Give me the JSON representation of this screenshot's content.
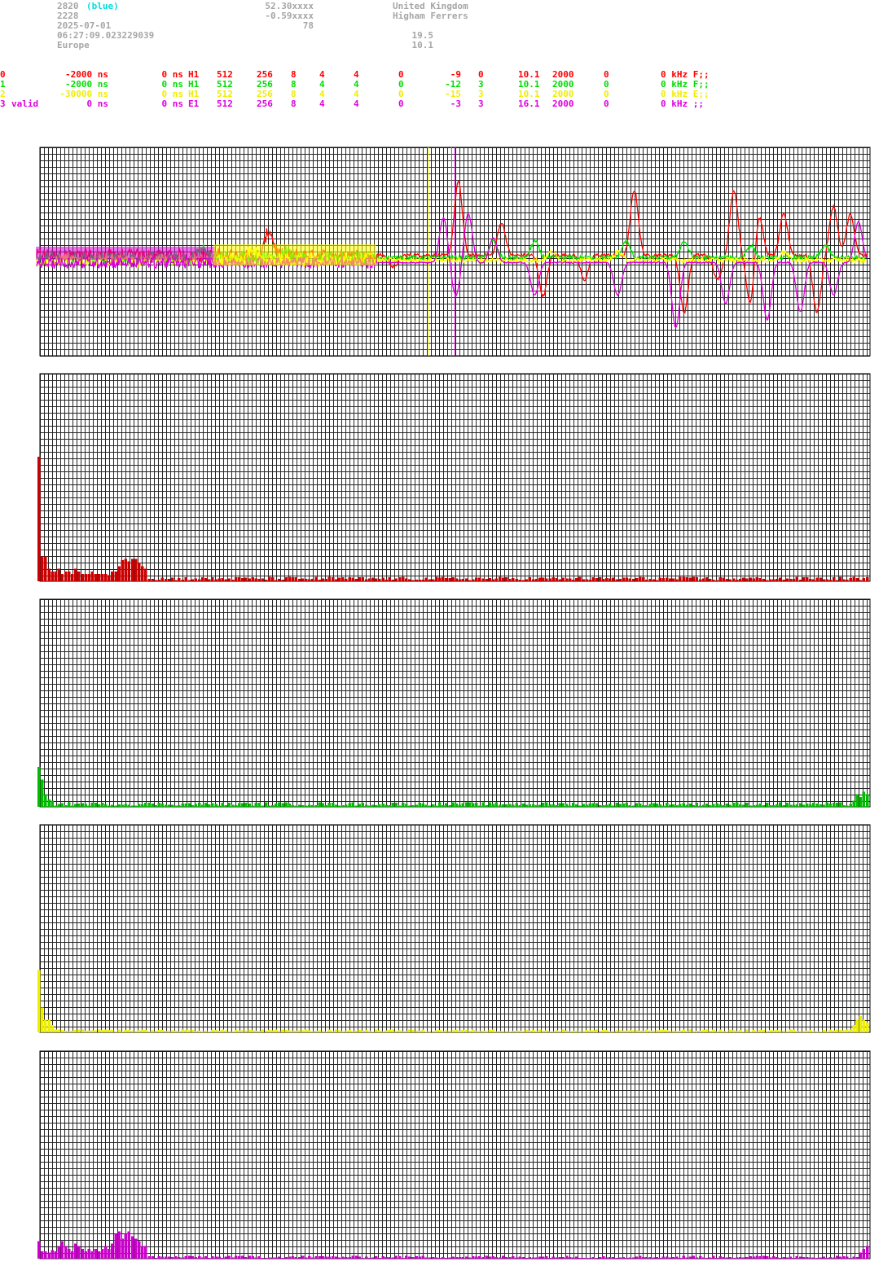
{
  "header": {
    "station": "2820",
    "station_note": "(blue)",
    "id2": "2228",
    "date": "2025-07-01",
    "time": "06:27:09.023229039",
    "region": "Europe",
    "lat": "52.30xxxx",
    "lon": "-0.59xxxx",
    "alt": "78",
    "country": "United Kingdom",
    "place": "Higham Ferrers",
    "val1": "19.5",
    "val2": "10.1"
  },
  "colors": {
    "ch0": "#ff0000",
    "ch1": "#00dd00",
    "ch2": "#ffff00",
    "ch3": "#dd00dd",
    "bar0": "#cc0000",
    "bar1": "#00bb00",
    "bar2": "#eeee00",
    "bar3": "#cc00cc",
    "grid": "#000000",
    "header": "#a6a6a6",
    "note": "#00dddd"
  },
  "channels": [
    {
      "idx": "0",
      "label": "",
      "offset": "-2000 ns",
      "z": "0 ns",
      "ant": "H1",
      "a": "512",
      "b": "256",
      "c": "8",
      "d": "4",
      "e": "4",
      "f": "0",
      "g": "-9",
      "h": "0",
      "i": "10.1",
      "j": "2000",
      "k": "0",
      "tail": "0 kHz F;;"
    },
    {
      "idx": "1",
      "label": "",
      "offset": "-2000 ns",
      "z": "0 ns",
      "ant": "H1",
      "a": "512",
      "b": "256",
      "c": "8",
      "d": "4",
      "e": "4",
      "f": "0",
      "g": "-12",
      "h": "3",
      "i": "10.1",
      "j": "2000",
      "k": "0",
      "tail": "0 kHz F;;"
    },
    {
      "idx": "2",
      "label": "",
      "offset": "-30000 ns",
      "z": "0 ns",
      "ant": "H1",
      "a": "512",
      "b": "256",
      "c": "8",
      "d": "4",
      "e": "4",
      "f": "0",
      "g": "-15",
      "h": "3",
      "i": "10.1",
      "j": "2000",
      "k": "0",
      "tail": "0 kHz E;;"
    },
    {
      "idx": "3",
      "label": "valid",
      "offset": "0 ns",
      "z": "0 ns",
      "ant": "E1",
      "a": "512",
      "b": "256",
      "c": "8",
      "d": "4",
      "e": "4",
      "f": "0",
      "g": "-3",
      "h": "3",
      "i": "16.1",
      "j": "2000",
      "k": "0",
      "tail": "0 kHz ;;"
    }
  ],
  "chart_data": [
    {
      "type": "line",
      "markers": [
        {
          "x": 0.468,
          "color": "#ffff00"
        },
        {
          "x": 0.496,
          "color": "#00dd00"
        },
        {
          "x": 0.5,
          "color": "#dd00dd"
        }
      ],
      "series": [
        {
          "channel": "0",
          "color": "#ff0000",
          "noise": 0.02,
          "events": [
            [
              0.28,
              0.3
            ],
            [
              0.43,
              -0.15
            ],
            [
              0.508,
              0.9
            ],
            [
              0.56,
              0.4
            ],
            [
              0.61,
              -0.5
            ],
            [
              0.66,
              -0.3
            ],
            [
              0.72,
              0.8
            ],
            [
              0.78,
              -0.7
            ],
            [
              0.82,
              -0.3
            ],
            [
              0.84,
              0.8
            ],
            [
              0.86,
              -0.6
            ],
            [
              0.87,
              0.5
            ],
            [
              0.9,
              0.5
            ],
            [
              0.94,
              -0.7
            ],
            [
              0.96,
              0.6
            ],
            [
              0.98,
              0.5
            ]
          ]
        },
        {
          "channel": "1",
          "color": "#00dd00",
          "noise": 0.025,
          "events": [
            [
              0.2,
              0.1
            ],
            [
              0.3,
              0.1
            ],
            [
              0.55,
              0.2
            ],
            [
              0.6,
              0.2
            ],
            [
              0.71,
              0.2
            ],
            [
              0.78,
              0.2
            ],
            [
              0.86,
              0.15
            ],
            [
              0.95,
              0.15
            ]
          ]
        },
        {
          "channel": "2",
          "color": "#ffff00",
          "noise": 0.03,
          "events": [
            [
              0.26,
              0.15
            ],
            [
              0.4,
              0.05
            ],
            [
              0.62,
              0.1
            ],
            [
              0.7,
              0.1
            ],
            [
              0.9,
              0.1
            ]
          ]
        },
        {
          "channel": "3",
          "color": "#dd00dd",
          "noise": 0.008,
          "events": [
            [
              0.49,
              0.55
            ],
            [
              0.505,
              -0.4
            ],
            [
              0.52,
              0.6
            ],
            [
              0.55,
              0.3
            ],
            [
              0.6,
              -0.4
            ],
            [
              0.7,
              -0.4
            ],
            [
              0.77,
              -0.8
            ],
            [
              0.83,
              -0.5
            ],
            [
              0.88,
              -0.7
            ],
            [
              0.92,
              -0.6
            ],
            [
              0.96,
              -0.4
            ],
            [
              0.99,
              0.5
            ]
          ]
        }
      ]
    },
    {
      "type": "bar",
      "channel": "0",
      "color": "#cc0000",
      "peak_bins": [
        [
          0,
          1.0
        ],
        [
          1,
          0.2
        ],
        [
          2,
          0.2
        ],
        [
          3,
          0.1
        ],
        [
          4,
          0.08
        ],
        [
          5,
          0.08
        ],
        [
          6,
          0.1
        ],
        [
          7,
          0.06
        ],
        [
          8,
          0.08
        ],
        [
          9,
          0.08
        ],
        [
          10,
          0.06
        ],
        [
          11,
          0.1
        ],
        [
          12,
          0.08
        ],
        [
          13,
          0.06
        ],
        [
          14,
          0.06
        ],
        [
          15,
          0.06
        ],
        [
          16,
          0.08
        ],
        [
          17,
          0.06
        ],
        [
          18,
          0.06
        ],
        [
          19,
          0.06
        ],
        [
          20,
          0.06
        ],
        [
          21,
          0.05
        ],
        [
          22,
          0.08
        ],
        [
          23,
          0.08
        ],
        [
          24,
          0.12
        ],
        [
          25,
          0.17
        ],
        [
          26,
          0.18
        ],
        [
          27,
          0.16
        ],
        [
          28,
          0.18
        ],
        [
          29,
          0.18
        ],
        [
          30,
          0.15
        ],
        [
          31,
          0.12
        ],
        [
          32,
          0.1
        ]
      ],
      "baseline": 0.03,
      "tail_bins": []
    },
    {
      "type": "bar",
      "channel": "1",
      "color": "#00bb00",
      "peak_bins": [
        [
          0,
          0.32
        ],
        [
          1,
          0.22
        ],
        [
          2,
          0.1
        ],
        [
          3,
          0.06
        ],
        [
          4,
          0.05
        ]
      ],
      "baseline": 0.03,
      "tail_bins": [
        [
          -4,
          0.05
        ],
        [
          -3,
          0.1
        ],
        [
          -2,
          0.08
        ],
        [
          -1,
          0.12
        ],
        [
          0,
          0.1
        ]
      ]
    },
    {
      "type": "bar",
      "channel": "2",
      "color": "#eeee00",
      "peak_bins": [
        [
          0,
          0.5
        ],
        [
          1,
          0.2
        ],
        [
          2,
          0.1
        ],
        [
          3,
          0.1
        ],
        [
          4,
          0.06
        ]
      ],
      "baseline": 0.02,
      "tail_bins": [
        [
          -4,
          0.06
        ],
        [
          -3,
          0.1
        ],
        [
          -2,
          0.13
        ],
        [
          -1,
          0.1
        ],
        [
          0,
          0.08
        ]
      ]
    },
    {
      "type": "bar",
      "channel": "3",
      "color": "#cc00cc",
      "peak_bins": [
        [
          0,
          0.14
        ],
        [
          1,
          0.06
        ],
        [
          2,
          0.06
        ],
        [
          3,
          0.05
        ],
        [
          4,
          0.07
        ],
        [
          5,
          0.06
        ],
        [
          6,
          0.1
        ],
        [
          7,
          0.14
        ],
        [
          8,
          0.1
        ],
        [
          9,
          0.08
        ],
        [
          10,
          0.06
        ],
        [
          11,
          0.12
        ],
        [
          12,
          0.1
        ],
        [
          13,
          0.08
        ],
        [
          14,
          0.06
        ],
        [
          15,
          0.08
        ],
        [
          16,
          0.06
        ],
        [
          17,
          0.08
        ],
        [
          18,
          0.06
        ],
        [
          19,
          0.08
        ],
        [
          20,
          0.1
        ],
        [
          21,
          0.08
        ],
        [
          22,
          0.12
        ],
        [
          23,
          0.2
        ],
        [
          24,
          0.22
        ],
        [
          25,
          0.16
        ],
        [
          26,
          0.2
        ],
        [
          27,
          0.22
        ],
        [
          28,
          0.18
        ],
        [
          29,
          0.16
        ],
        [
          30,
          0.14
        ],
        [
          31,
          0.1
        ],
        [
          32,
          0.1
        ]
      ],
      "baseline": 0.02,
      "tail_bins": [
        [
          -2,
          0.05
        ],
        [
          -1,
          0.08
        ],
        [
          0,
          0.1
        ]
      ]
    }
  ]
}
